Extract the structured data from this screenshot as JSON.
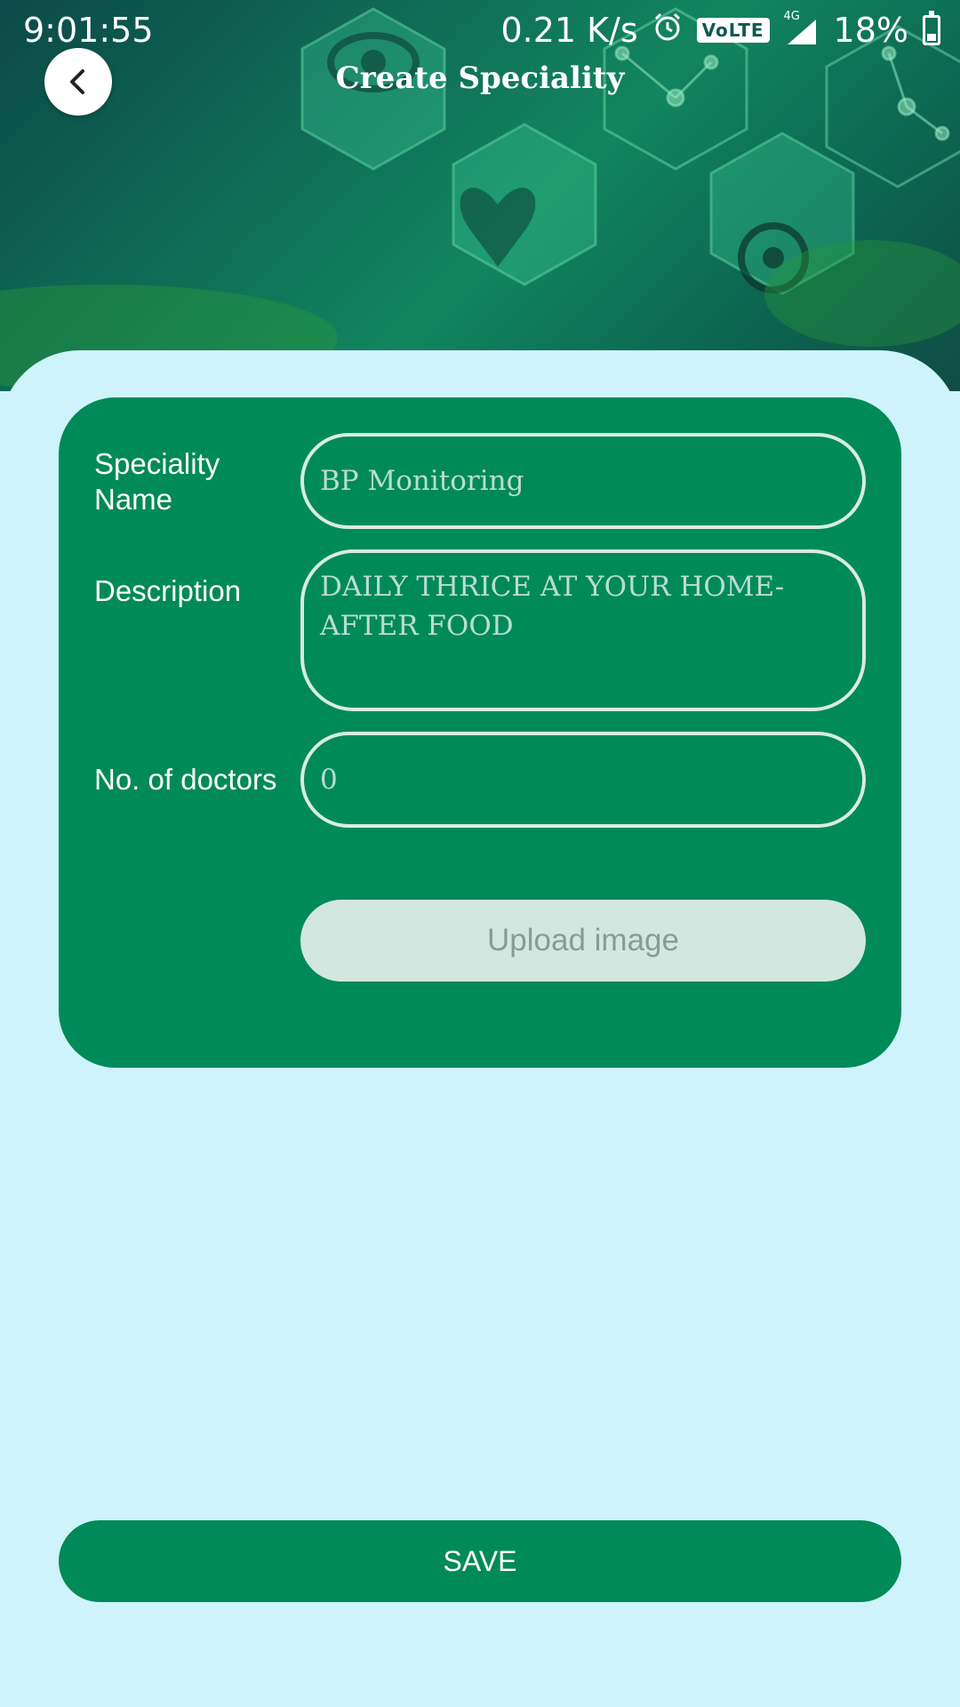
{
  "status_bar": {
    "time": "9:01:55",
    "net_speed": "0.21 K/s",
    "volte": "VoLTE",
    "network": "4G",
    "battery": "18%"
  },
  "header": {
    "title": "Create Speciality",
    "back_icon": "chevron-left-icon"
  },
  "form": {
    "speciality_name_label": "Speciality\nName",
    "speciality_name_value": "BP Monitoring",
    "description_label": "Description",
    "description_value": "DAILY THRICE AT YOUR HOME-\nAFTER FOOD",
    "doctors_label": "No. of doctors",
    "doctors_value": "0",
    "upload_label": "Upload image"
  },
  "save_label": "SAVE",
  "colors": {
    "accent": "#018a59",
    "background": "#cff3fb",
    "upload_button": "#d3e7e1"
  }
}
